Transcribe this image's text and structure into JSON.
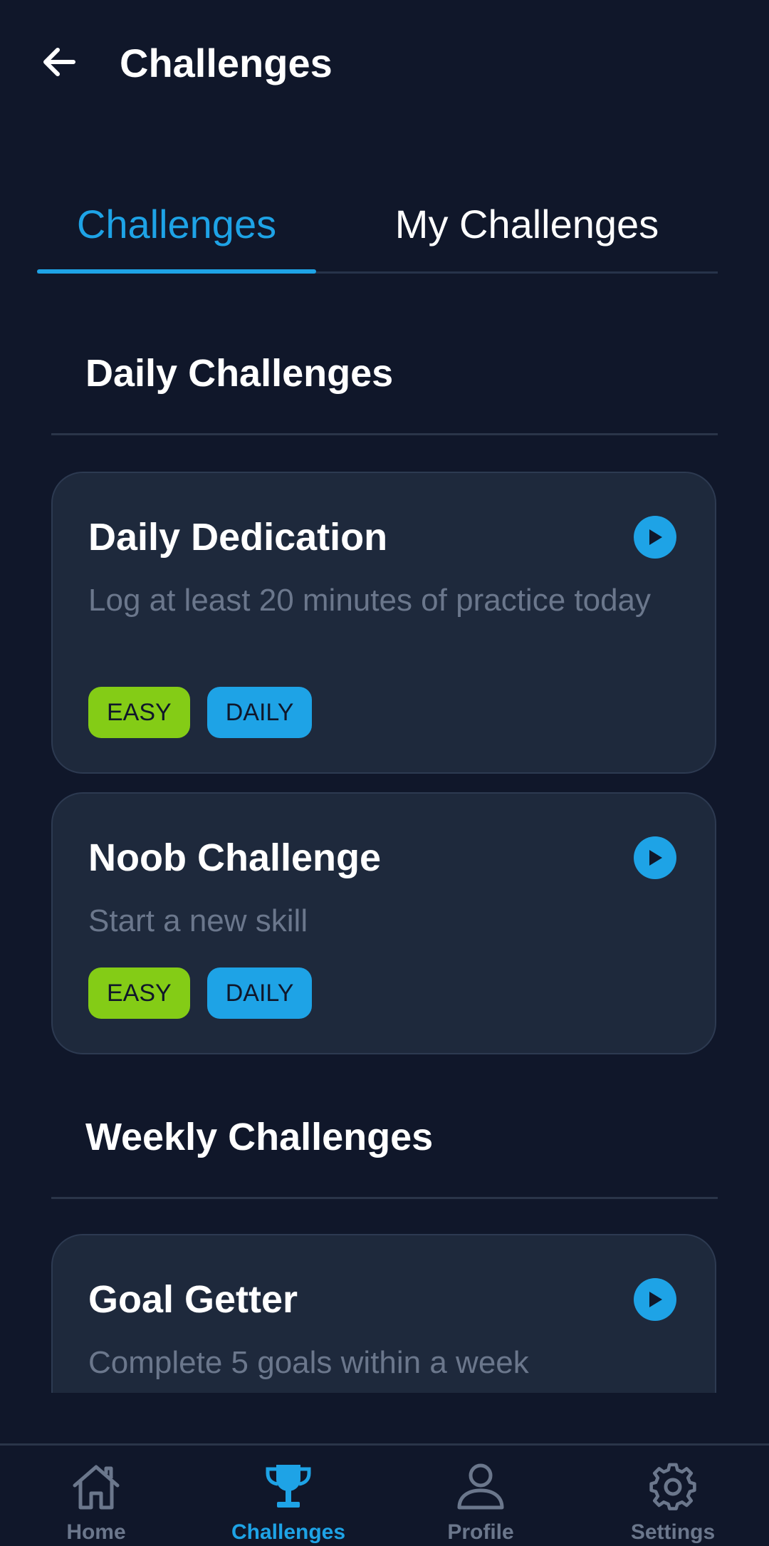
{
  "header": {
    "title": "Challenges",
    "back_icon": "arrow-left-icon"
  },
  "tabs": [
    {
      "label": "Challenges",
      "active": true
    },
    {
      "label": "My Challenges",
      "active": false
    }
  ],
  "sections": {
    "daily": {
      "title": "Daily Challenges",
      "cards": [
        {
          "title": "Daily Dedication",
          "description": "Log at least 20 minutes of practice today",
          "badges": [
            "EASY",
            "DAILY"
          ]
        },
        {
          "title": "Noob Challenge",
          "description": "Start a new skill",
          "badges": [
            "EASY",
            "DAILY"
          ]
        }
      ]
    },
    "weekly": {
      "title": "Weekly Challenges",
      "cards": [
        {
          "title": "Goal Getter",
          "description": "Complete 5 goals within a week"
        }
      ]
    }
  },
  "bottom_nav": [
    {
      "label": "Home",
      "icon": "home-icon",
      "active": false
    },
    {
      "label": "Challenges",
      "icon": "trophy-icon",
      "active": true
    },
    {
      "label": "Profile",
      "icon": "person-icon",
      "active": false
    },
    {
      "label": "Settings",
      "icon": "gear-icon",
      "active": false
    }
  ],
  "colors": {
    "background": "#10172a",
    "card": "#1e293c",
    "accent": "#1ea3e6",
    "easy_badge": "#84cc16",
    "muted_text": "#6b778c"
  }
}
